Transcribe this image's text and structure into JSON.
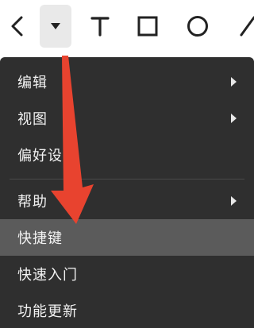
{
  "toolbar": {
    "icons": [
      "chevron-left-icon",
      "caret-down-icon",
      "text-tool-icon",
      "rectangle-tool-icon",
      "circle-tool-icon",
      "line-tool-icon"
    ]
  },
  "menu": {
    "items": [
      {
        "label": "编辑",
        "has_submenu": true
      },
      {
        "label": "视图",
        "has_submenu": true
      },
      {
        "label": "偏好设置",
        "has_submenu": false
      },
      {
        "label": "帮助",
        "has_submenu": true
      },
      {
        "label": "快捷键",
        "has_submenu": false,
        "highlighted": true
      },
      {
        "label": "快速入门",
        "has_submenu": false
      },
      {
        "label": "功能更新",
        "has_submenu": false
      }
    ]
  },
  "colors": {
    "menu_background": "#2f2f2f",
    "menu_highlight": "#5b5b5b",
    "annotation_arrow": "#e8432f"
  }
}
